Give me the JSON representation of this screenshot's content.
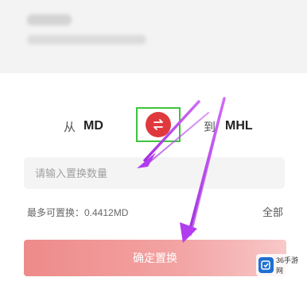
{
  "header": {
    "title_blurred": "",
    "subtitle_blurred": ""
  },
  "exchange": {
    "from_label": "从",
    "from_asset": "MD",
    "to_label": "到",
    "to_asset": "MHL",
    "swap_icon": "swap-arrows-icon"
  },
  "amount": {
    "placeholder": "请输入置换数量",
    "value": ""
  },
  "limits": {
    "max_label": "最多可置换：0.4412MD",
    "all_label": "全部"
  },
  "actions": {
    "confirm_label": "确定置换"
  },
  "watermark": {
    "text": "36手游网"
  },
  "colors": {
    "accent_red": "#e0393d",
    "highlight_green": "#3ec43e",
    "annotation_purple": "#b23cf0",
    "button_pink": "#f3a4a4"
  }
}
